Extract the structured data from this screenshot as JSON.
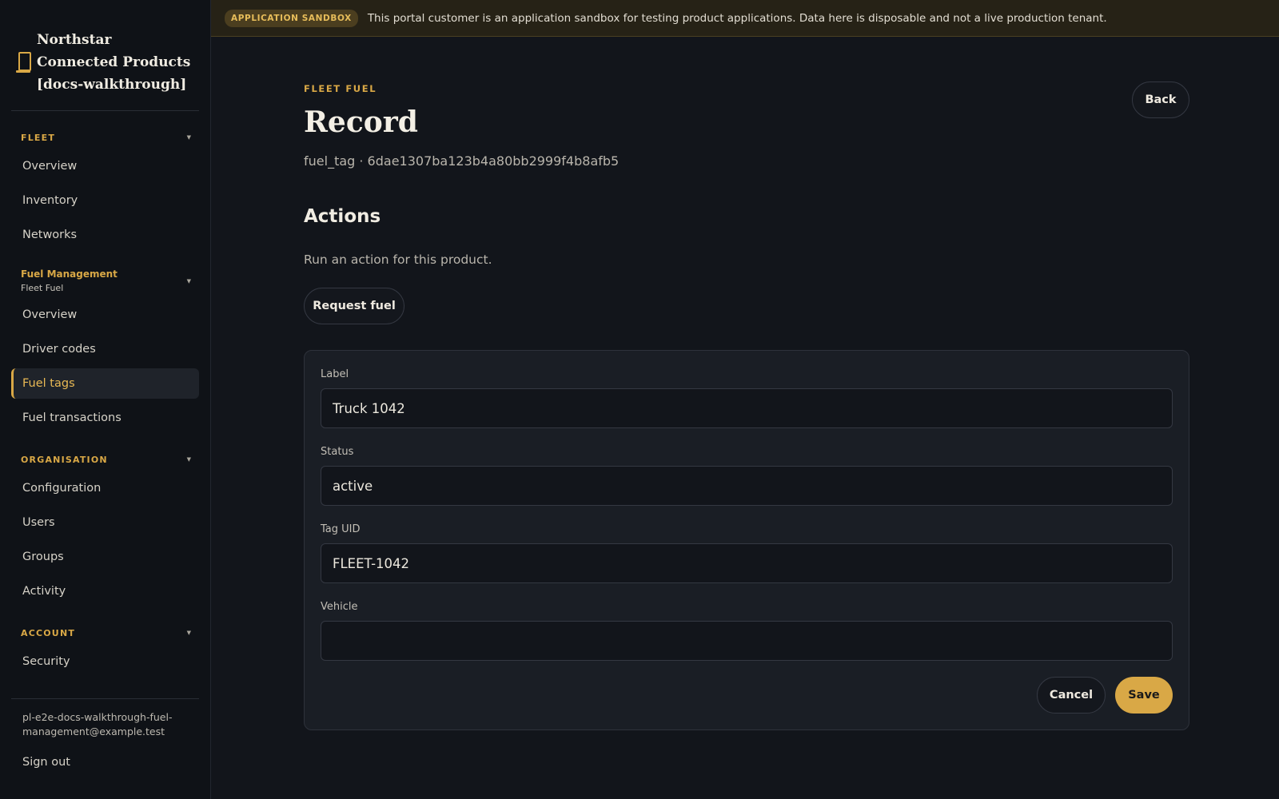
{
  "brand": {
    "name": "Northstar Connected Products [docs-walkthrough]",
    "icon": "lantern-icon"
  },
  "sidebar": {
    "fleet": {
      "label": "FLEET",
      "items": [
        "Overview",
        "Inventory",
        "Networks"
      ]
    },
    "fuel": {
      "title": "Fuel Management",
      "subtitle": "Fleet Fuel",
      "items": [
        "Overview",
        "Driver codes",
        "Fuel tags",
        "Fuel transactions"
      ],
      "active": "Fuel tags"
    },
    "organisation": {
      "label": "ORGANISATION",
      "items": [
        "Configuration",
        "Users",
        "Groups",
        "Activity"
      ]
    },
    "account": {
      "label": "ACCOUNT",
      "items": [
        "Security"
      ]
    },
    "user_email": "pl-e2e-docs-walkthrough-fuel-management@example.test",
    "signout": "Sign out"
  },
  "banner": {
    "badge": "APPLICATION SANDBOX",
    "text": "This portal customer is an application sandbox for testing product applications. Data here is disposable and not a live production tenant."
  },
  "page": {
    "eyebrow": "FLEET FUEL",
    "title": "Record",
    "subtitle": "fuel_tag · 6dae1307ba123b4a80bb2999f4b8afb5",
    "back_label": "Back",
    "actions_title": "Actions",
    "actions_desc": "Run an action for this product.",
    "request_fuel_label": "Request fuel"
  },
  "form": {
    "label": {
      "label": "Label",
      "value": "Truck 1042"
    },
    "status": {
      "label": "Status",
      "value": "active"
    },
    "tag_uid": {
      "label": "Tag UID",
      "value": "FLEET-1042"
    },
    "vehicle": {
      "label": "Vehicle",
      "value": ""
    },
    "cancel_label": "Cancel",
    "save_label": "Save"
  },
  "colors": {
    "accent": "#d9a846",
    "background": "#12151b",
    "sidebar": "#0f1217",
    "banner": "#262216"
  }
}
